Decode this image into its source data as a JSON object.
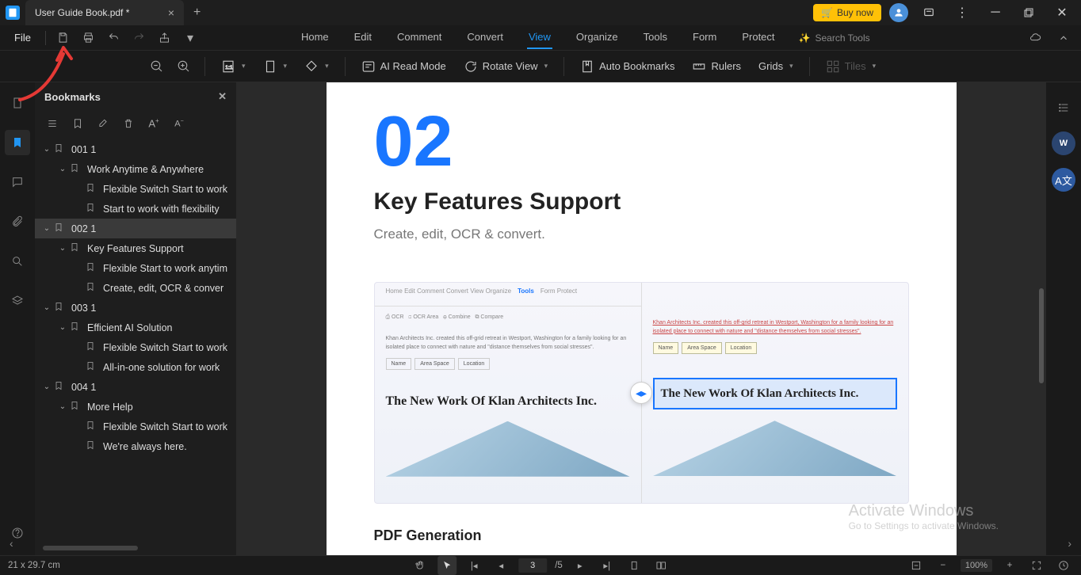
{
  "titlebar": {
    "tab_name": "User Guide Book.pdf *",
    "buy_label": "Buy now"
  },
  "menubar": {
    "file_label": "File",
    "tabs": [
      "Home",
      "Edit",
      "Comment",
      "Convert",
      "View",
      "Organize",
      "Tools",
      "Form",
      "Protect"
    ],
    "active_tab": "View",
    "search_placeholder": "Search Tools"
  },
  "ribbon": {
    "ai_read_mode": "AI Read Mode",
    "rotate_view": "Rotate View",
    "auto_bookmarks": "Auto Bookmarks",
    "rulers": "Rulers",
    "grids": "Grids",
    "tiles": "Tiles"
  },
  "panel": {
    "title": "Bookmarks"
  },
  "bookmarks": [
    {
      "level": 0,
      "open": true,
      "label": "001 1"
    },
    {
      "level": 1,
      "open": true,
      "label": "Work Anytime & Anywhere"
    },
    {
      "level": 2,
      "open": null,
      "label": "Flexible Switch Start to work"
    },
    {
      "level": 2,
      "open": null,
      "label": "Start to work with flexibility"
    },
    {
      "level": 0,
      "open": true,
      "label": "002 1",
      "selected": true
    },
    {
      "level": 1,
      "open": true,
      "label": "Key Features Support"
    },
    {
      "level": 2,
      "open": null,
      "label": "Flexible Start to work anytim"
    },
    {
      "level": 2,
      "open": null,
      "label": "Create, edit, OCR & conver"
    },
    {
      "level": 0,
      "open": true,
      "label": "003 1"
    },
    {
      "level": 1,
      "open": true,
      "label": "Efficient AI Solution"
    },
    {
      "level": 2,
      "open": null,
      "label": "Flexible Switch Start to work"
    },
    {
      "level": 2,
      "open": null,
      "label": "All-in-one solution for work"
    },
    {
      "level": 0,
      "open": true,
      "label": "004 1"
    },
    {
      "level": 1,
      "open": true,
      "label": "More Help"
    },
    {
      "level": 2,
      "open": null,
      "label": "Flexible Switch Start to work"
    },
    {
      "level": 2,
      "open": null,
      "label": "We're always here."
    }
  ],
  "page": {
    "num": "02",
    "title": "Key Features Support",
    "subtitle": "Create, edit, OCR & convert.",
    "media_headline": "The New Work Of Klan Architects Inc.",
    "pdf_gen": "PDF Generation"
  },
  "statusbar": {
    "dims": "21 x 29.7 cm",
    "page_current": "3",
    "page_total": "/5",
    "zoom": "100%"
  },
  "watermark": {
    "l1": "Activate Windows",
    "l2": "Go to Settings to activate Windows."
  }
}
